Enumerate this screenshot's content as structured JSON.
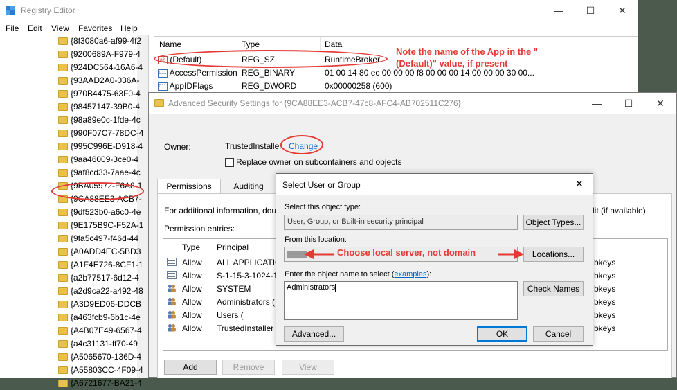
{
  "registry": {
    "title": "Registry Editor",
    "menu": [
      "File",
      "Edit",
      "View",
      "Favorites",
      "Help"
    ],
    "tree_items": [
      "{8f3080a6-af99-4f2",
      "{9200689A-F979-4",
      "{924DC564-16A6-4",
      "{93AAD2A0-036A-",
      "{970B4475-63F0-4",
      "{98457147-39B0-4",
      "{98a89e0c-1fde-4c",
      "{990F07C7-78DC-4",
      "{995C996E-D918-4",
      "{9aa46009-3ce0-4",
      "{9af8cd33-7aae-4c",
      "{9BA05972-F6A8-1",
      "{9CA88EE3-ACB7-",
      "{9df523b0-a6c0-4e",
      "{9E175B9C-F52A-1",
      "{9fa5c497-f46d-44",
      "{A0ADD4EC-5BD3",
      "{A1F4E726-8CF1-1",
      "{a2b77517-6d12-4",
      "{a2d9ca22-a492-48",
      "{A3D9ED06-DDCB",
      "{a463fcb9-6b1c-4e",
      "{A4B07E49-6567-4",
      "{a4c31131-ff70-49",
      "{A5065670-136D-4",
      "{A55803CC-4F09-4",
      "{A6721677-BA21-4"
    ],
    "columns": {
      "name": "Name",
      "type": "Type",
      "data": "Data"
    },
    "values": [
      {
        "name": "(Default)",
        "type": "REG_SZ",
        "data": "RuntimeBroker"
      },
      {
        "name": "AccessPermission",
        "type": "REG_BINARY",
        "data": "01 00 14 80 ec 00 00 00 f8 00 00 00 14 00 00 00 30 00..."
      },
      {
        "name": "AppIDFlags",
        "type": "REG_DWORD",
        "data": "0x00000258 (600)"
      }
    ],
    "annotation": "Note the name of the App in the \"(Default)\" value, if present"
  },
  "advsec": {
    "title": "Advanced Security Settings for {9CA88EE3-ACB7-47c8-AFC4-AB702511C276}",
    "owner_label": "Owner:",
    "owner_value": "TrustedInstaller",
    "change_link": "Change",
    "replace_owner": "Replace owner on subcontainers and objects",
    "tabs": [
      "Permissions",
      "Auditing"
    ],
    "info_left": "For additional information, dou",
    "info_right": "dit (if available).",
    "perm_entries": "Permission entries:",
    "col_type": "Type",
    "col_principal": "Principal",
    "entries": [
      {
        "type": "Allow",
        "principal": "ALL APPLICATIO",
        "right": "bkeys"
      },
      {
        "type": "Allow",
        "principal": "S-1-15-3-1024-1",
        "right": "bkeys"
      },
      {
        "type": "Allow",
        "principal": "SYSTEM",
        "right": "bkeys"
      },
      {
        "type": "Allow",
        "principal": "Administrators (",
        "right": "bkeys"
      },
      {
        "type": "Allow",
        "principal": "Users (",
        "right": "bkeys"
      },
      {
        "type": "Allow",
        "principal": "TrustedInstaller",
        "right": "bkeys"
      }
    ],
    "add_btn": "Add",
    "remove_btn": "Remove",
    "view_btn": "View"
  },
  "sel": {
    "title": "Select User or Group",
    "obj_type_label": "Select this object type:",
    "obj_type_value": "User, Group, or Built-in security principal",
    "obj_types_btn": "Object Types...",
    "location_label": "From this location:",
    "locations_btn": "Locations...",
    "enter_label": "Enter the object name to select (",
    "examples_link": "examples",
    "enter_label_end": "):",
    "name_value": "Administrators",
    "check_names_btn": "Check Names",
    "advanced_btn": "Advanced...",
    "ok_btn": "OK",
    "cancel_btn": "Cancel",
    "annotation": "Choose local server, not domain"
  },
  "colors": {
    "annotation": "#e53935",
    "accent": "#0078d7"
  }
}
